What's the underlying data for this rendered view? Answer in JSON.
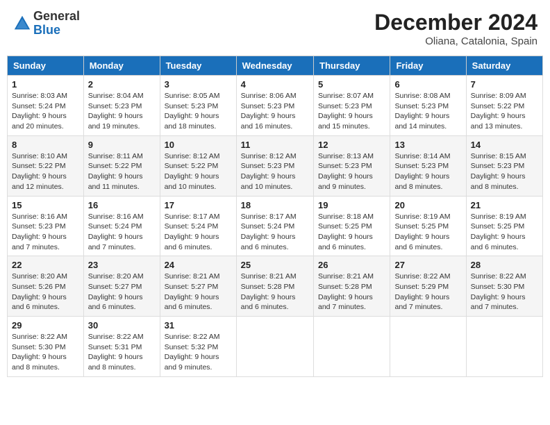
{
  "header": {
    "logo_general": "General",
    "logo_blue": "Blue",
    "month": "December 2024",
    "location": "Oliana, Catalonia, Spain"
  },
  "weekdays": [
    "Sunday",
    "Monday",
    "Tuesday",
    "Wednesday",
    "Thursday",
    "Friday",
    "Saturday"
  ],
  "weeks": [
    [
      {
        "day": "1",
        "sunrise": "Sunrise: 8:03 AM",
        "sunset": "Sunset: 5:24 PM",
        "daylight": "Daylight: 9 hours and 20 minutes."
      },
      {
        "day": "2",
        "sunrise": "Sunrise: 8:04 AM",
        "sunset": "Sunset: 5:23 PM",
        "daylight": "Daylight: 9 hours and 19 minutes."
      },
      {
        "day": "3",
        "sunrise": "Sunrise: 8:05 AM",
        "sunset": "Sunset: 5:23 PM",
        "daylight": "Daylight: 9 hours and 18 minutes."
      },
      {
        "day": "4",
        "sunrise": "Sunrise: 8:06 AM",
        "sunset": "Sunset: 5:23 PM",
        "daylight": "Daylight: 9 hours and 16 minutes."
      },
      {
        "day": "5",
        "sunrise": "Sunrise: 8:07 AM",
        "sunset": "Sunset: 5:23 PM",
        "daylight": "Daylight: 9 hours and 15 minutes."
      },
      {
        "day": "6",
        "sunrise": "Sunrise: 8:08 AM",
        "sunset": "Sunset: 5:23 PM",
        "daylight": "Daylight: 9 hours and 14 minutes."
      },
      {
        "day": "7",
        "sunrise": "Sunrise: 8:09 AM",
        "sunset": "Sunset: 5:22 PM",
        "daylight": "Daylight: 9 hours and 13 minutes."
      }
    ],
    [
      {
        "day": "8",
        "sunrise": "Sunrise: 8:10 AM",
        "sunset": "Sunset: 5:22 PM",
        "daylight": "Daylight: 9 hours and 12 minutes."
      },
      {
        "day": "9",
        "sunrise": "Sunrise: 8:11 AM",
        "sunset": "Sunset: 5:22 PM",
        "daylight": "Daylight: 9 hours and 11 minutes."
      },
      {
        "day": "10",
        "sunrise": "Sunrise: 8:12 AM",
        "sunset": "Sunset: 5:22 PM",
        "daylight": "Daylight: 9 hours and 10 minutes."
      },
      {
        "day": "11",
        "sunrise": "Sunrise: 8:12 AM",
        "sunset": "Sunset: 5:23 PM",
        "daylight": "Daylight: 9 hours and 10 minutes."
      },
      {
        "day": "12",
        "sunrise": "Sunrise: 8:13 AM",
        "sunset": "Sunset: 5:23 PM",
        "daylight": "Daylight: 9 hours and 9 minutes."
      },
      {
        "day": "13",
        "sunrise": "Sunrise: 8:14 AM",
        "sunset": "Sunset: 5:23 PM",
        "daylight": "Daylight: 9 hours and 8 minutes."
      },
      {
        "day": "14",
        "sunrise": "Sunrise: 8:15 AM",
        "sunset": "Sunset: 5:23 PM",
        "daylight": "Daylight: 9 hours and 8 minutes."
      }
    ],
    [
      {
        "day": "15",
        "sunrise": "Sunrise: 8:16 AM",
        "sunset": "Sunset: 5:23 PM",
        "daylight": "Daylight: 9 hours and 7 minutes."
      },
      {
        "day": "16",
        "sunrise": "Sunrise: 8:16 AM",
        "sunset": "Sunset: 5:24 PM",
        "daylight": "Daylight: 9 hours and 7 minutes."
      },
      {
        "day": "17",
        "sunrise": "Sunrise: 8:17 AM",
        "sunset": "Sunset: 5:24 PM",
        "daylight": "Daylight: 9 hours and 6 minutes."
      },
      {
        "day": "18",
        "sunrise": "Sunrise: 8:17 AM",
        "sunset": "Sunset: 5:24 PM",
        "daylight": "Daylight: 9 hours and 6 minutes."
      },
      {
        "day": "19",
        "sunrise": "Sunrise: 8:18 AM",
        "sunset": "Sunset: 5:25 PM",
        "daylight": "Daylight: 9 hours and 6 minutes."
      },
      {
        "day": "20",
        "sunrise": "Sunrise: 8:19 AM",
        "sunset": "Sunset: 5:25 PM",
        "daylight": "Daylight: 9 hours and 6 minutes."
      },
      {
        "day": "21",
        "sunrise": "Sunrise: 8:19 AM",
        "sunset": "Sunset: 5:25 PM",
        "daylight": "Daylight: 9 hours and 6 minutes."
      }
    ],
    [
      {
        "day": "22",
        "sunrise": "Sunrise: 8:20 AM",
        "sunset": "Sunset: 5:26 PM",
        "daylight": "Daylight: 9 hours and 6 minutes."
      },
      {
        "day": "23",
        "sunrise": "Sunrise: 8:20 AM",
        "sunset": "Sunset: 5:27 PM",
        "daylight": "Daylight: 9 hours and 6 minutes."
      },
      {
        "day": "24",
        "sunrise": "Sunrise: 8:21 AM",
        "sunset": "Sunset: 5:27 PM",
        "daylight": "Daylight: 9 hours and 6 minutes."
      },
      {
        "day": "25",
        "sunrise": "Sunrise: 8:21 AM",
        "sunset": "Sunset: 5:28 PM",
        "daylight": "Daylight: 9 hours and 6 minutes."
      },
      {
        "day": "26",
        "sunrise": "Sunrise: 8:21 AM",
        "sunset": "Sunset: 5:28 PM",
        "daylight": "Daylight: 9 hours and 7 minutes."
      },
      {
        "day": "27",
        "sunrise": "Sunrise: 8:22 AM",
        "sunset": "Sunset: 5:29 PM",
        "daylight": "Daylight: 9 hours and 7 minutes."
      },
      {
        "day": "28",
        "sunrise": "Sunrise: 8:22 AM",
        "sunset": "Sunset: 5:30 PM",
        "daylight": "Daylight: 9 hours and 7 minutes."
      }
    ],
    [
      {
        "day": "29",
        "sunrise": "Sunrise: 8:22 AM",
        "sunset": "Sunset: 5:30 PM",
        "daylight": "Daylight: 9 hours and 8 minutes."
      },
      {
        "day": "30",
        "sunrise": "Sunrise: 8:22 AM",
        "sunset": "Sunset: 5:31 PM",
        "daylight": "Daylight: 9 hours and 8 minutes."
      },
      {
        "day": "31",
        "sunrise": "Sunrise: 8:22 AM",
        "sunset": "Sunset: 5:32 PM",
        "daylight": "Daylight: 9 hours and 9 minutes."
      },
      null,
      null,
      null,
      null
    ]
  ]
}
